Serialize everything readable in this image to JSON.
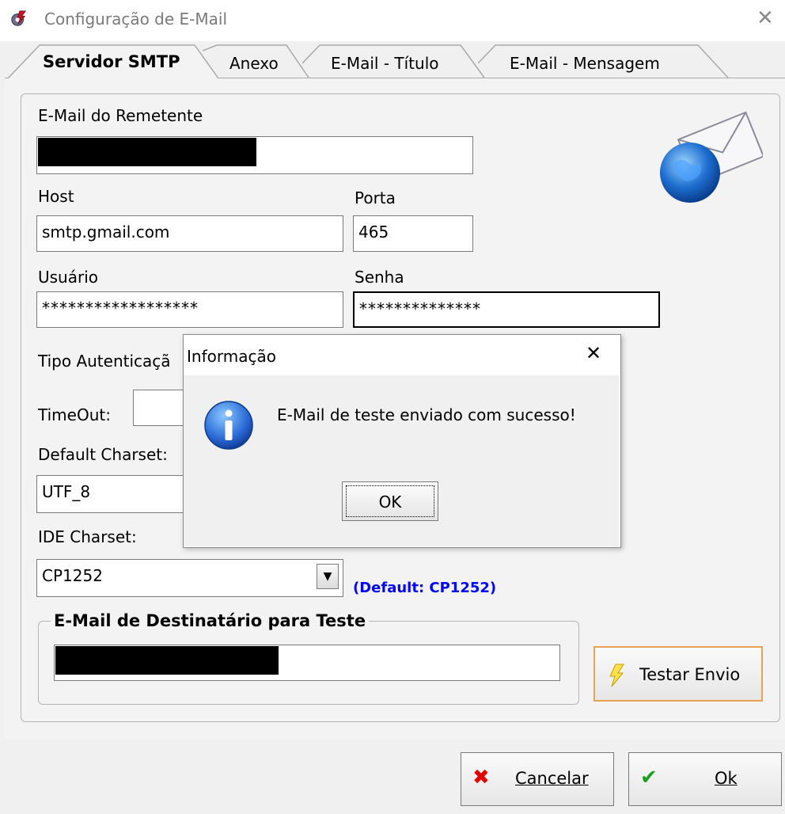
{
  "window": {
    "title": "Configuração de E-Mail",
    "close_glyph": "✕",
    "app_icon": "gear-lightning-icon"
  },
  "tabs": [
    {
      "label": "Servidor SMTP",
      "active": true
    },
    {
      "label": "Anexo",
      "active": false
    },
    {
      "label": "E-Mail - Título",
      "active": false
    },
    {
      "label": "E-Mail - Mensagem",
      "active": false
    }
  ],
  "form": {
    "remetente_label": "E-Mail do Remetente",
    "remetente_value": "",
    "host_label": "Host",
    "host_value": "smtp.gmail.com",
    "porta_label": "Porta",
    "porta_value": "465",
    "usuario_label": "Usuário",
    "usuario_value": "******************",
    "senha_label": "Senha",
    "senha_value": "**************",
    "tipo_auth_label": "Tipo Autenticaçã",
    "timeout_label": "TimeOut:",
    "timeout_value": "",
    "default_charset_label": "Default Charset:",
    "default_charset_value": "UTF_8",
    "ide_charset_label": "IDE Charset:",
    "ide_charset_value": "CP1252",
    "ide_charset_default": "(Default: CP1252)",
    "email_icon": "globe-envelope-icon"
  },
  "test_group": {
    "title": "E-Mail de Destinatário para Teste",
    "recipient_value": "",
    "test_button_label": "Testar Envio",
    "test_button_icon": "lightning-icon"
  },
  "footer": {
    "cancel_label": "Cancelar",
    "cancel_icon": "red-x-icon",
    "ok_label": "Ok",
    "ok_icon": "green-check-icon"
  },
  "dialog": {
    "title": "Informação",
    "close_glyph": "✕",
    "message": "E-Mail de teste enviado com sucesso!",
    "ok_label": "OK",
    "icon": "info-icon"
  },
  "colors": {
    "accent_blue": "#0000ff",
    "test_button_border": "#e8a253"
  }
}
